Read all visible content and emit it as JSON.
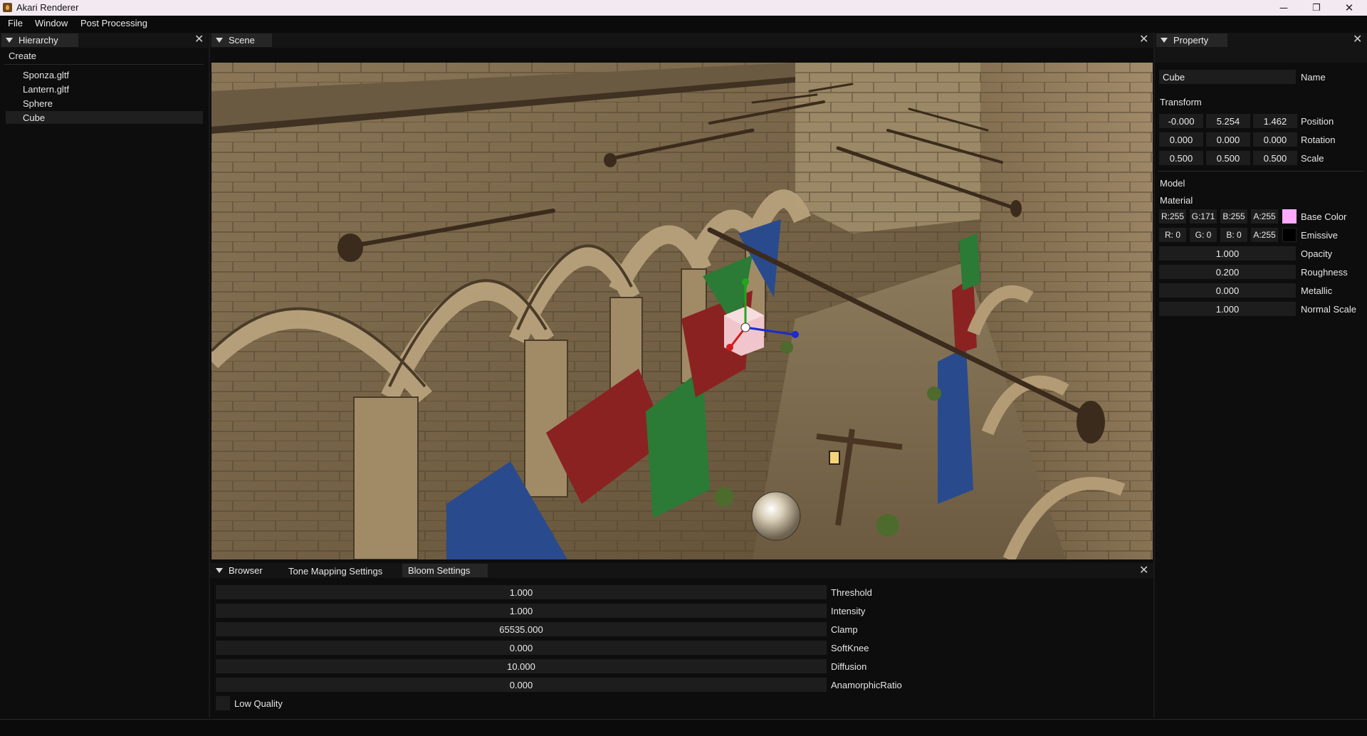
{
  "window": {
    "title": "Akari Renderer",
    "minimize_glyph": "─",
    "maximize_glyph": "❐",
    "close_glyph": "✕"
  },
  "menu": [
    "File",
    "Window",
    "Post Processing"
  ],
  "hierarchy": {
    "tab": "Hierarchy",
    "create": "Create",
    "items": [
      "Sponza.gltf",
      "Lantern.gltf",
      "Sphere",
      "Cube"
    ],
    "selected": "Cube"
  },
  "scene": {
    "tab": "Scene"
  },
  "property": {
    "tab": "Property",
    "name_value": "Cube",
    "name_label": "Name",
    "transform_label": "Transform",
    "position": [
      "-0.000",
      "5.254",
      "1.462"
    ],
    "position_label": "Position",
    "rotation": [
      "0.000",
      "0.000",
      "0.000"
    ],
    "rotation_label": "Rotation",
    "scale": [
      "0.500",
      "0.500",
      "0.500"
    ],
    "scale_label": "Scale",
    "model_label": "Model",
    "material_label": "Material",
    "base_color": [
      "R:255",
      "G:171",
      "B:255",
      "A:255"
    ],
    "base_color_label": "Base Color",
    "base_color_swatch": "#ffabff",
    "emissive": [
      "R: 0",
      "G: 0",
      "B: 0",
      "A:255"
    ],
    "emissive_label": "Emissive",
    "emissive_swatch": "#000000",
    "opacity": "1.000",
    "opacity_label": "Opacity",
    "roughness": "0.200",
    "roughness_label": "Roughness",
    "metallic": "0.000",
    "metallic_label": "Metallic",
    "normal_scale": "1.000",
    "normal_scale_label": "Normal Scale"
  },
  "bottom": {
    "tabs": [
      "Browser",
      "Tone Mapping Settings",
      "Bloom Settings"
    ],
    "active_tab": "Bloom Settings",
    "bloom": [
      {
        "value": "1.000",
        "label": "Threshold"
      },
      {
        "value": "1.000",
        "label": "Intensity"
      },
      {
        "value": "65535.000",
        "label": "Clamp"
      },
      {
        "value": "0.000",
        "label": "SoftKnee"
      },
      {
        "value": "10.000",
        "label": "Diffusion"
      },
      {
        "value": "0.000",
        "label": "AnamorphicRatio"
      }
    ],
    "low_quality_label": "Low Quality",
    "low_quality_checked": false
  },
  "colors": {
    "panel_bg": "#0d0d0d",
    "field_bg": "#1d1d1d",
    "tab_active": "#262626",
    "gizmo_x": "#d01c1c",
    "gizmo_y": "#1ea81e",
    "gizmo_z": "#1c2ad0"
  },
  "icons": {
    "app": "akari-flame-icon",
    "panel_menu": "triangle-down-icon",
    "close": "close-icon"
  }
}
